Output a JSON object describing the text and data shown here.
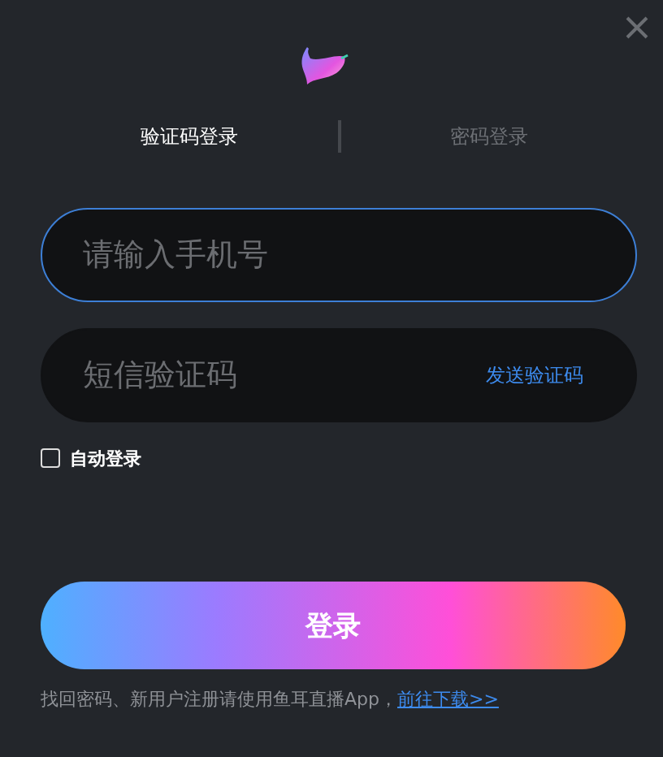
{
  "tabs": [
    {
      "label": "验证码登录",
      "selected": true
    },
    {
      "label": "密码登录",
      "selected": false
    }
  ],
  "phone_field": {
    "placeholder": "请输入手机号",
    "focused": true
  },
  "code_field": {
    "placeholder": "短信验证码",
    "action": "发送验证码"
  },
  "auto_login": {
    "label": "自动登录",
    "checked": false
  },
  "login_button": "登录",
  "footer": {
    "text": "找回密码、新用户注册请使用鱼耳直播App，",
    "link": "前往下载>>"
  }
}
